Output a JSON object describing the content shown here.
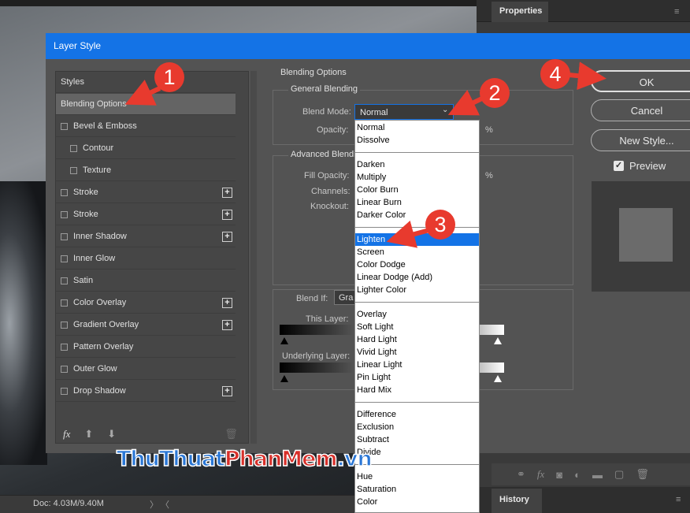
{
  "app": {
    "properties_tab": "Properties",
    "history_tab": "History",
    "doc_size": "Doc: 4.03M/9.40M"
  },
  "dialog": {
    "title": "Layer Style",
    "styles_header": "Styles",
    "styles": [
      {
        "label": "Blending Options",
        "checkbox": false,
        "sub": false,
        "plus": false,
        "selected": true
      },
      {
        "label": "Bevel & Emboss",
        "checkbox": true,
        "sub": false,
        "plus": false
      },
      {
        "label": "Contour",
        "checkbox": true,
        "sub": true,
        "plus": false
      },
      {
        "label": "Texture",
        "checkbox": true,
        "sub": true,
        "plus": false
      },
      {
        "label": "Stroke",
        "checkbox": true,
        "sub": false,
        "plus": true
      },
      {
        "label": "Stroke",
        "checkbox": true,
        "sub": false,
        "plus": true
      },
      {
        "label": "Inner Shadow",
        "checkbox": true,
        "sub": false,
        "plus": true
      },
      {
        "label": "Inner Glow",
        "checkbox": true,
        "sub": false,
        "plus": false
      },
      {
        "label": "Satin",
        "checkbox": true,
        "sub": false,
        "plus": false
      },
      {
        "label": "Color Overlay",
        "checkbox": true,
        "sub": false,
        "plus": true
      },
      {
        "label": "Gradient Overlay",
        "checkbox": true,
        "sub": false,
        "plus": true
      },
      {
        "label": "Pattern Overlay",
        "checkbox": true,
        "sub": false,
        "plus": false
      },
      {
        "label": "Outer Glow",
        "checkbox": true,
        "sub": false,
        "plus": false
      },
      {
        "label": "Drop Shadow",
        "checkbox": true,
        "sub": false,
        "plus": true
      }
    ],
    "fx_label": "fx",
    "blending": {
      "section_title": "Blending Options",
      "general_title": "General Blending",
      "blend_mode_label": "Blend Mode:",
      "blend_mode_value": "Normal",
      "opacity_label": "Opacity:",
      "pct": "%",
      "advanced_title": "Advanced Blendin",
      "fill_opacity_label": "Fill Opacity:",
      "channels_label": "Channels:",
      "knockout_label": "Knockout:",
      "blend_if_label": "Blend If:",
      "blend_if_value": "Gra",
      "this_layer_label": "This Layer:",
      "underlying_layer_label": "Underlying Layer:"
    },
    "blend_modes": [
      [
        "Normal",
        "Dissolve"
      ],
      [
        "Darken",
        "Multiply",
        "Color Burn",
        "Linear Burn",
        "Darker Color"
      ],
      [
        "Lighten",
        "Screen",
        "Color Dodge",
        "Linear Dodge (Add)",
        "Lighter Color"
      ],
      [
        "Overlay",
        "Soft Light",
        "Hard Light",
        "Vivid Light",
        "Linear Light",
        "Pin Light",
        "Hard Mix"
      ],
      [
        "Difference",
        "Exclusion",
        "Subtract",
        "Divide"
      ],
      [
        "Hue",
        "Saturation",
        "Color"
      ]
    ],
    "selected_blend_mode": "Lighten",
    "buttons": {
      "ok": "OK",
      "cancel": "Cancel",
      "new_style": "New Style..."
    },
    "preview_label": "Preview",
    "preview_checked": true
  },
  "annotations": [
    "1",
    "2",
    "3",
    "4"
  ],
  "watermark": {
    "part1": "ThuThuat",
    "part2": "PhanMem",
    "part3": ".vn"
  },
  "colors": {
    "accent": "#1473e6",
    "annotation": "#e83a2e"
  }
}
